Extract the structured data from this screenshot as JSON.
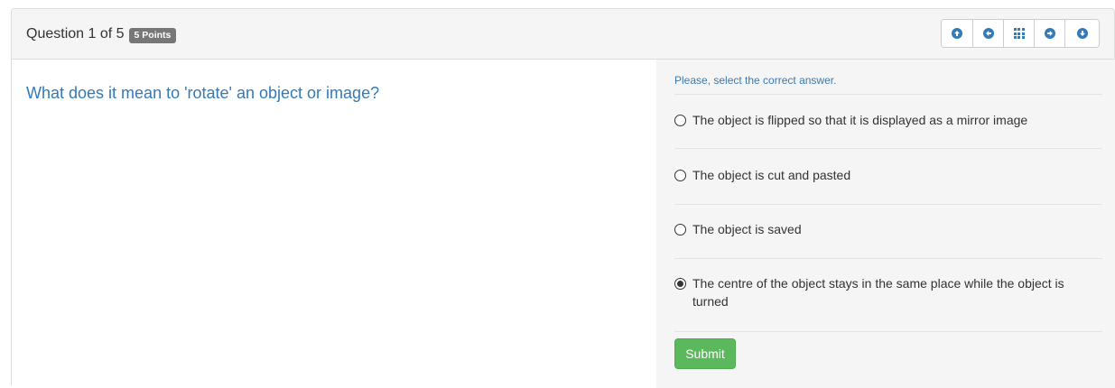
{
  "header": {
    "question_counter": "Question 1 of 5",
    "points_badge": "5 Points",
    "nav_icons": [
      "arrow-up-circle-icon",
      "arrow-left-circle-icon",
      "grid-icon",
      "arrow-right-circle-icon",
      "arrow-down-circle-icon"
    ]
  },
  "question": {
    "text": "What does it mean to 'rotate' an object or image?"
  },
  "answers": {
    "instruction": "Please, select the correct answer.",
    "options": [
      {
        "label": "The object is flipped so that it is displayed as a mirror image",
        "selected": false
      },
      {
        "label": "The object is cut and pasted",
        "selected": false
      },
      {
        "label": "The object is saved",
        "selected": false
      },
      {
        "label": "The centre of the object stays in the same place while the object is turned",
        "selected": true
      }
    ],
    "submit_label": "Submit"
  },
  "colors": {
    "accent": "#337ab7",
    "submit": "#5cb85c",
    "badge": "#777777",
    "panel_bg": "#f5f5f5"
  }
}
